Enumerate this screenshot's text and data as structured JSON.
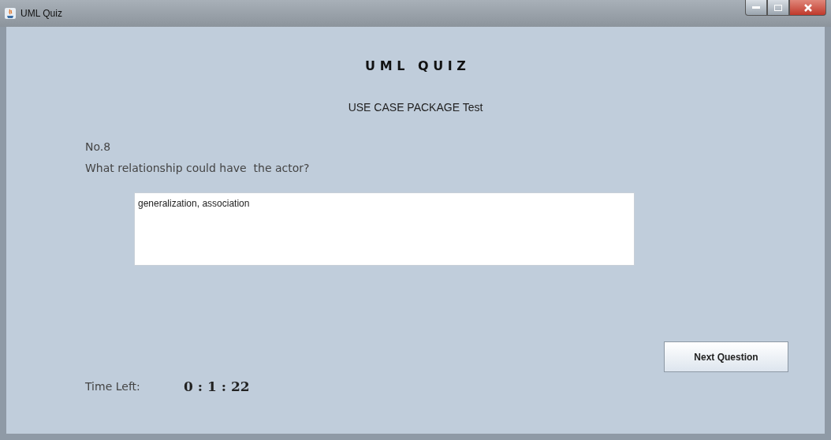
{
  "window": {
    "title": "UML Quiz"
  },
  "heading": "U M L   Q U I Z",
  "subtitle": "USE CASE PACKAGE Test",
  "question": {
    "number": "No.8",
    "text": "What relationship could have  the actor?"
  },
  "answer": {
    "value": "generalization, association"
  },
  "next_button": "Next Question",
  "timer": {
    "label": "Time Left:",
    "value": "0 : 1 : 22"
  }
}
